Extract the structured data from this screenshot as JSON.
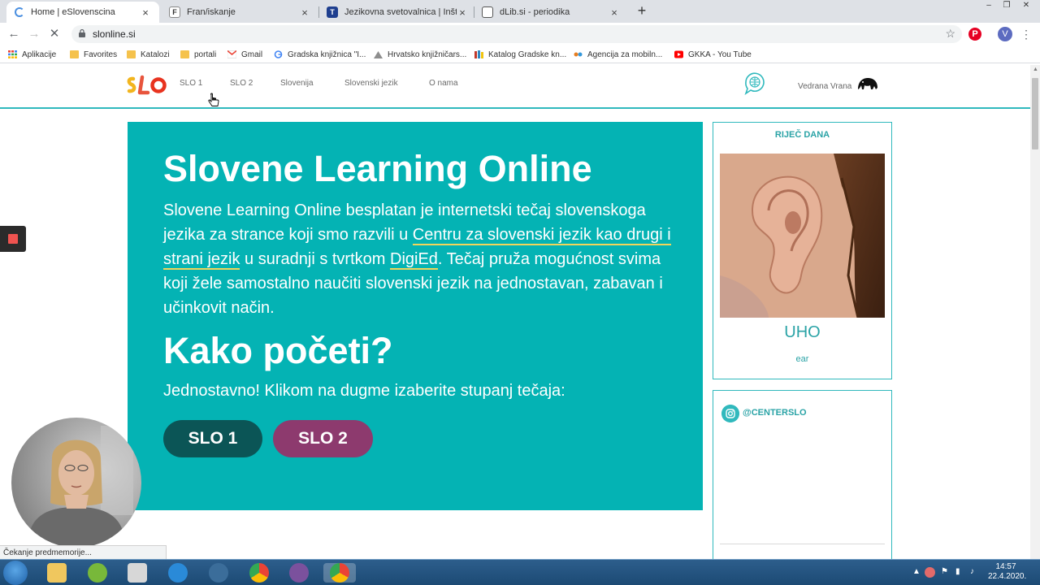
{
  "browser": {
    "tabs": [
      {
        "title": "Home | eSlovenscina",
        "active": true,
        "favicon": "spinner-icon"
      },
      {
        "title": "Fran/iskanje",
        "active": false,
        "favicon": "f-icon"
      },
      {
        "title": "Jezikovna svetovalnica | Inštitut z",
        "active": false,
        "favicon": "t-icon"
      },
      {
        "title": "dLib.si - periodika",
        "active": false,
        "favicon": "dlib-icon"
      }
    ],
    "new_tab": "+",
    "window_controls": [
      "–",
      "❐",
      "✕"
    ],
    "url": "slonline.si",
    "bookmarks": [
      {
        "label": "Aplikacije",
        "icon": "apps-icon"
      },
      {
        "label": "Favorites",
        "icon": "folder-icon"
      },
      {
        "label": "Katalozi",
        "icon": "folder-icon"
      },
      {
        "label": "portali",
        "icon": "folder-icon"
      },
      {
        "label": "Gmail",
        "icon": "gmail-icon"
      },
      {
        "label": "Gradska knjižnica \"I...",
        "icon": "google-icon"
      },
      {
        "label": "Hrvatsko knjižničars...",
        "icon": "hkd-icon"
      },
      {
        "label": "Katalog Gradske kn...",
        "icon": "catalog-icon"
      },
      {
        "label": "Agencija za mobiln...",
        "icon": "agency-icon"
      },
      {
        "label": "GKKA - You Tube",
        "icon": "youtube-icon"
      }
    ],
    "profile_initial": "V",
    "status_text": "Čekanje predmemorije..."
  },
  "site": {
    "nav": [
      "SLO 1",
      "SLO 2",
      "Slovenija",
      "Slovenski jezik",
      "O nama"
    ],
    "user_name": "Vedrana Vrana",
    "hero": {
      "title": "Slovene Learning Online",
      "intro_1": "Slovene Learning Online besplatan je internetski tečaj slovenskoga jezika za strance koji smo razvili u ",
      "link_centre": " Centru za slovenski jezik kao drugi i strani jezik",
      "intro_2": " u suradnji s tvrtkom ",
      "link_digied": "DigiEd",
      "intro_3": ". Tečaj pruža mogućnost svima koji žele samostalno naučiti slovenski jezik na jednostavan, zabavan i učinkovit način.",
      "heading_2": "Kako početi?",
      "subtitle": "Jednostavno! Klikom na dugme izaberite stupanj tečaja:",
      "button_1": "SLO 1",
      "button_2": "SLO 2"
    },
    "word_of_day": {
      "header": "RIJEČ DANA",
      "word": "UHO",
      "translation": "ear"
    },
    "instagram": {
      "handle": "@CENTERSLO"
    }
  },
  "taskbar": {
    "clock_time": "14:57",
    "clock_date": "22.4.2020."
  },
  "colors": {
    "teal": "#04b3b4",
    "slo1_button": "#0b5556",
    "slo2_button": "#8d3a6e",
    "accent_text": "#2aa3a6",
    "link_underline": "#f2d55a"
  }
}
